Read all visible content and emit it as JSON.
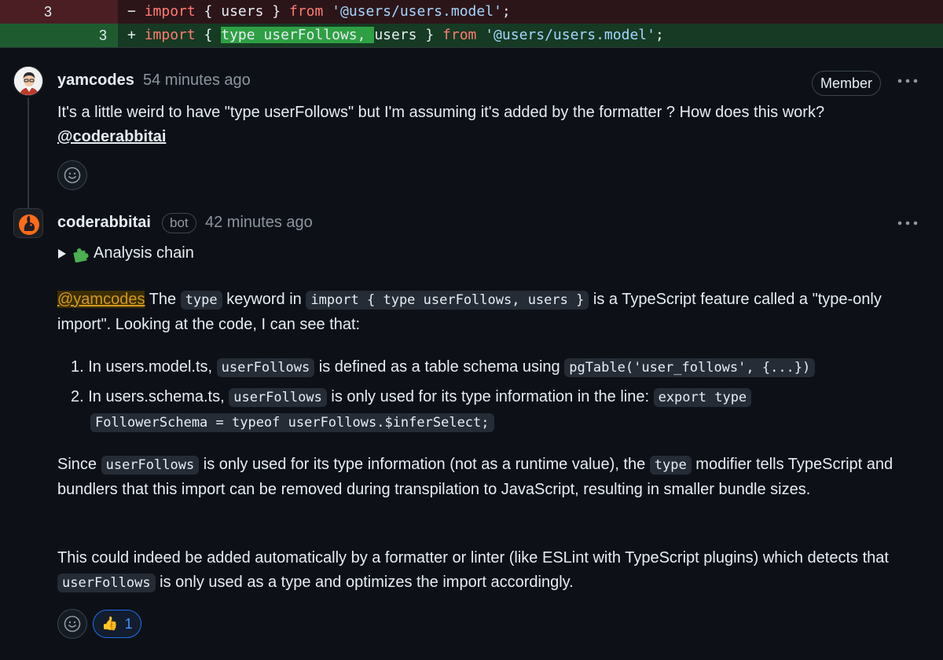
{
  "diff": {
    "deleted": {
      "old_line": "3",
      "sign": "−",
      "kw_import": "import",
      "text_a": " { users } ",
      "kw_from": "from",
      "space": " ",
      "string": "'@users/users.model'",
      "end": ";"
    },
    "added": {
      "new_line": "3",
      "sign": "+",
      "kw_import": "import",
      "text_a": " { ",
      "highlight": "type userFollows, ",
      "text_b": "users } ",
      "kw_from": "from",
      "space": " ",
      "string": "'@users/users.model'",
      "end": ";"
    }
  },
  "comments": [
    {
      "author": "yamcodes",
      "time": "54 minutes ago",
      "badge": "Member",
      "body": "It's a little weird to have \"type userFollows\" but I'm assuming it's added by the formatter ? How does this work?",
      "mention": "@coderabbitai"
    },
    {
      "author": "coderabbitai",
      "badge": "bot",
      "time": "42 minutes ago",
      "analysis_chain": "Analysis chain",
      "p1": {
        "mention": "@yamcodes",
        "t1": " The ",
        "c1": "type",
        "t2": " keyword in ",
        "c2": "import { type userFollows, users }",
        "t3": " is a TypeScript feature called a \"type-only import\". Looking at the code, I can see that:"
      },
      "list": [
        {
          "num": "1.",
          "t1": "In users.model.ts, ",
          "c1": "userFollows",
          "t2": " is defined as a table schema using ",
          "c2": "pgTable('user_follows', {...})"
        },
        {
          "num": "2.",
          "t1": "In users.schema.ts, ",
          "c1": "userFollows",
          "t2": " is only used for its type information in the line: ",
          "c2a": "export type",
          "c2b": "FollowerSchema = typeof userFollows.$inferSelect;"
        }
      ],
      "p2": {
        "t1": "Since ",
        "c1": "userFollows",
        "t2": " is only used for its type information (not as a runtime value), the ",
        "c2": "type",
        "t3": " modifier tells TypeScript and bundlers that this import can be removed during transpilation to JavaScript, resulting in smaller bundle sizes."
      },
      "p3": {
        "t1": "This could indeed be added automatically by a formatter or linter (like ESLint with TypeScript plugins) which detects that ",
        "c1": "userFollows",
        "t2": " is only used as a type and optimizes the import accordingly."
      },
      "reaction": {
        "emoji": "👍",
        "count": "1"
      }
    }
  ],
  "icons": {
    "kebab": "more-horizontal-icon",
    "smiley": "smiley-icon",
    "puzzle": "puzzle-icon",
    "caret": "triangle-right-icon"
  },
  "colors": {
    "background": "#0d1117",
    "deleted_row": "#2c1519",
    "added_row": "#163a23",
    "mention_highlight": "#d29922",
    "reaction_accent": "#4493f8"
  }
}
